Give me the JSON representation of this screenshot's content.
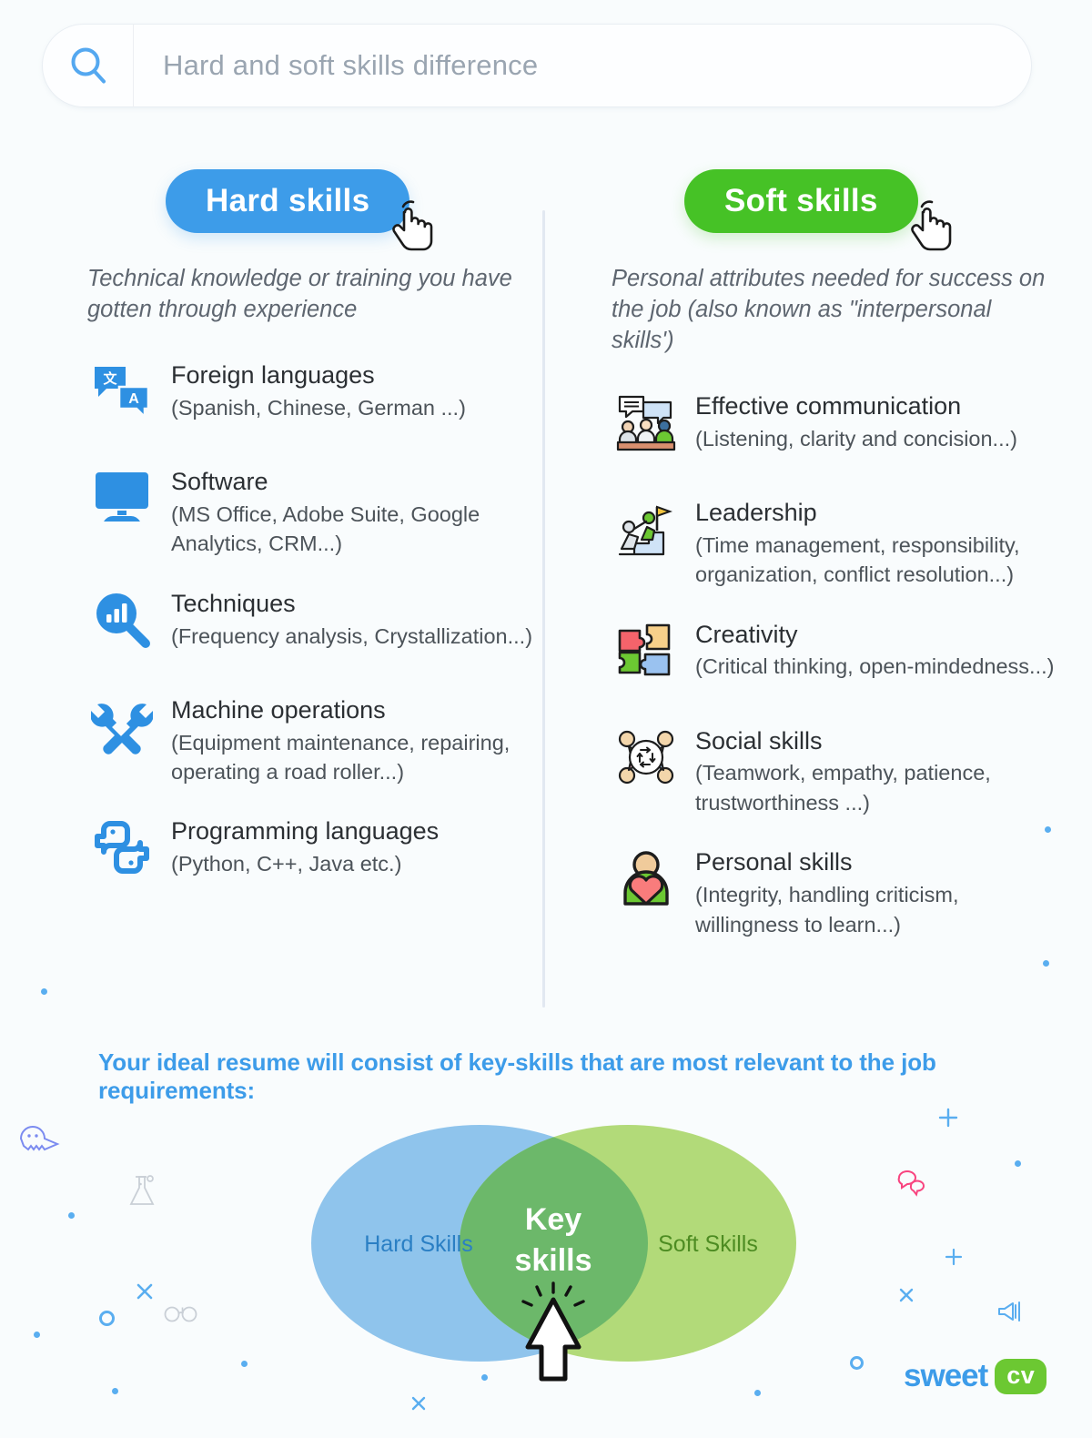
{
  "search": {
    "placeholder": "Hard and soft skills difference",
    "value": "",
    "icon": "search-icon"
  },
  "columns": {
    "hard": {
      "label": "Hard skills",
      "color": "#3d9ce9",
      "description": "Technical knowledge or training you have gotten through experience",
      "items": [
        {
          "icon": "translate-icon",
          "title": "Foreign languages",
          "sub": "(Spanish, Chinese, German ...)"
        },
        {
          "icon": "monitor-icon",
          "title": "Software",
          "sub": "(MS Office, Adobe Suite, Google Analytics, CRM...)"
        },
        {
          "icon": "chart-search-icon",
          "title": "Techniques",
          "sub": "(Frequency analysis, Crystallization...)"
        },
        {
          "icon": "tools-icon",
          "title": "Machine operations",
          "sub": "(Equipment maintenance, repairing, operating a road roller...)"
        },
        {
          "icon": "python-icon",
          "title": "Programming languages",
          "sub": "(Python, C++, Java etc.)"
        }
      ]
    },
    "soft": {
      "label": "Soft skills",
      "color": "#46c226",
      "description": "Personal attributes needed for success on the job (also known as \"interpersonal skills')",
      "items": [
        {
          "icon": "people-talking-icon",
          "title": "Effective communication",
          "sub": "(Listening, clarity and concision...)"
        },
        {
          "icon": "stairs-flag-icon",
          "title": "Leadership",
          "sub": "(Time management, responsibility, organization, conflict resolution...)"
        },
        {
          "icon": "puzzle-icon",
          "title": "Creativity",
          "sub": "(Critical thinking, open-mindedness...)"
        },
        {
          "icon": "network-people-icon",
          "title": "Social skills",
          "sub": "(Teamwork, empathy, patience, trustworthiness ...)"
        },
        {
          "icon": "person-heart-icon",
          "title": "Personal skills",
          "sub": "(Integrity, handling criticism, willingness to learn...)"
        }
      ]
    }
  },
  "bottom": {
    "headline": "Your ideal resume will consist of key-skills that are most relevant to the job requirements:",
    "headline_color": "#3d9ce9"
  },
  "chart_data": {
    "type": "venn",
    "title": "Your ideal resume will consist of key-skills that are most relevant to the job requirements:",
    "sets": [
      {
        "name": "Hard Skills",
        "label": "Hard Skills",
        "color": "#8fc4ec",
        "label_color": "#2a7fc4"
      },
      {
        "name": "Soft Skills",
        "label": "Soft Skills",
        "color": "#b2da79",
        "label_color": "#4d8c22"
      }
    ],
    "intersection": {
      "label": "Key skills",
      "color": "#6cb86a",
      "label_color": "#ffffff"
    },
    "annotation": "arrow-cursor pointing at intersection"
  },
  "logo": {
    "word": "sweet",
    "badge": "cv",
    "word_color": "#3d9ce9",
    "badge_color": "#6cc832"
  },
  "decorations": [
    {
      "name": "ghost-icon",
      "color": "#7b8bf0"
    },
    {
      "name": "flask-icon",
      "color": "#c9cfd6"
    },
    {
      "name": "glasses-icon",
      "color": "#c9cfd6"
    },
    {
      "name": "speech-bubbles-icon",
      "color": "#f8447f"
    },
    {
      "name": "megaphone-icon",
      "color": "#5aaef0"
    },
    {
      "name": "plus-mark",
      "color": "#5aaef0"
    },
    {
      "name": "x-mark",
      "color": "#5aaef0"
    },
    {
      "name": "dot-mark",
      "color": "#5aaef0"
    },
    {
      "name": "ring-mark",
      "color": "#5aaef0"
    }
  ]
}
